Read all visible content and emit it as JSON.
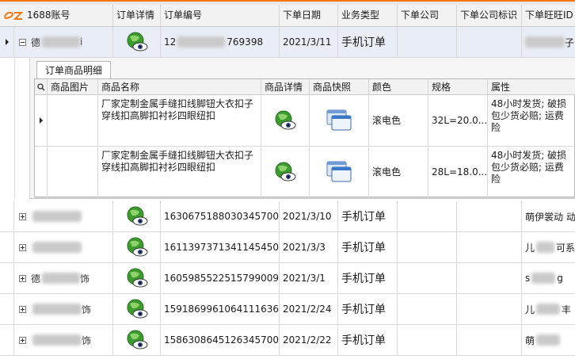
{
  "columns": {
    "account": "1688账号",
    "order_detail": "订单详情",
    "order_no": "订单编号",
    "order_date": "下单日期",
    "biz_type": "业务类型",
    "company": "下单公司",
    "company_id": "下单公司标识",
    "wangwang_id": "下单旺旺ID"
  },
  "first_row": {
    "account": "德",
    "account_suffix": "i",
    "order_no": "12",
    "order_no_suffix": "769398",
    "order_date": "2021/3/11",
    "biz_type": "手机订单",
    "wangwang_suffix": "子"
  },
  "detail": {
    "tab_label": "订单商品明细",
    "search_icon": "search-icon",
    "columns": {
      "image": "商品图片",
      "name": "商品名称",
      "detail": "商品详情",
      "snapshot": "商品快照",
      "color": "颜色",
      "spec": "规格",
      "attr": "属性"
    },
    "items": [
      {
        "name": "厂家定制金属手缝扣线脚钮大衣扣子穿线扣高脚扣衬衫四眼纽扣",
        "color": "滚电色",
        "spec": "32L=20.0...",
        "attr": "48小时发货; 破损包少货必赔; 运费险"
      },
      {
        "name": "厂家定制金属手缝扣线脚钮大衣扣子穿线扣高脚扣衬衫四眼纽扣",
        "color": "滚电色",
        "spec": "28L=18.0...",
        "attr": "48小时发货; 破损包少货必赔; 运费险"
      }
    ]
  },
  "rows": [
    {
      "account": "",
      "order_no": "1630675188030345700",
      "order_date": "2021/3/10",
      "biz_type": "手机订单",
      "wangwang": "萌伊裳动",
      "wangwang_suffix": "动"
    },
    {
      "account": "",
      "order_no": "1611397371341145450",
      "order_date": "2021/3/3",
      "biz_type": "手机订单",
      "wangwang": "儿",
      "wangwang_suffix": "可系"
    },
    {
      "account": "德",
      "account_suffix": "饰",
      "order_no": "1605985522515799009",
      "order_date": "2021/3/1",
      "biz_type": "手机订单",
      "wangwang": "s",
      "wangwang_suffix": "g"
    },
    {
      "account": "",
      "account_suffix": "饰",
      "order_no": "1591869961064111636",
      "order_date": "2021/2/24",
      "biz_type": "手机订单",
      "wangwang": "儿",
      "wangwang_suffix": "丰"
    },
    {
      "account": "",
      "account_suffix": "饰",
      "order_no": "1586308645126345700",
      "order_date": "2021/2/22",
      "biz_type": "手机订单",
      "wangwang": "萌",
      "wangwang_suffix": ""
    }
  ],
  "colors": {
    "accent": "#f47a10",
    "header_bg": "#f2f2f2",
    "selected_row": "#e9eef6"
  }
}
